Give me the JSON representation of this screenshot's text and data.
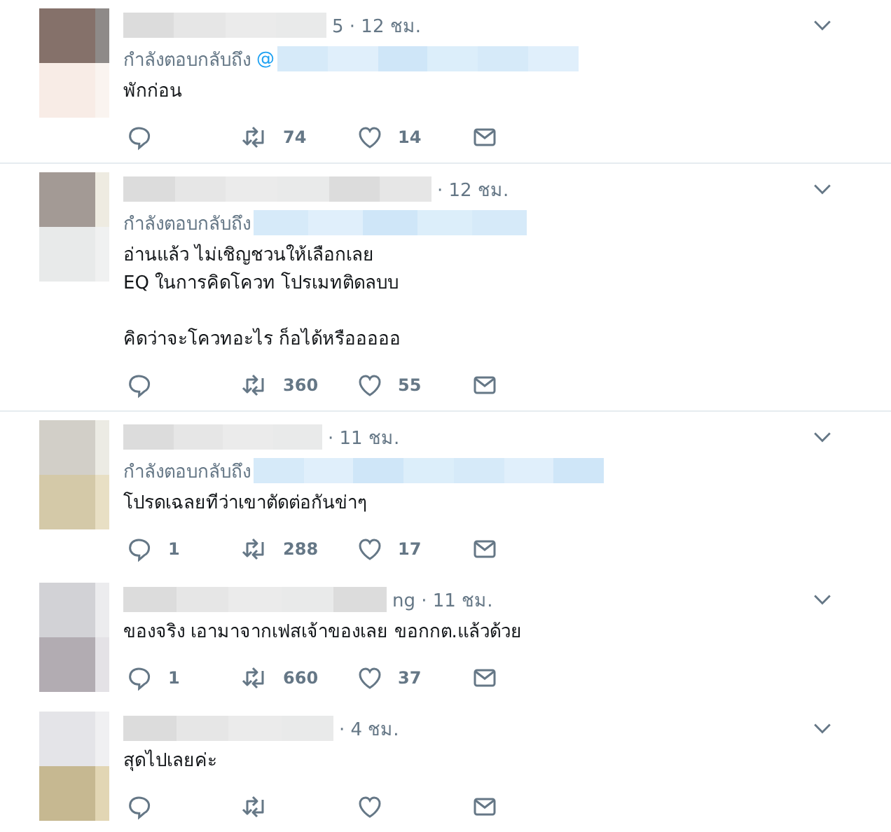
{
  "threads": [
    {
      "tweets": [
        {
          "time": "5 · 12 ชม.",
          "reply_to": {
            "label": "กำลังตอบกลับถึง",
            "handle": "@"
          },
          "text": "พักก่อน",
          "actions": {
            "retweets": "74",
            "likes": "14"
          }
        }
      ]
    },
    {
      "tweets": [
        {
          "time": "· 12 ชม.",
          "reply_to": {
            "label": "กำลังตอบกลับถึง"
          },
          "text": "อ่านแล้ว ไม่เชิญชวนให้เลือกเลย\nEQ ในการคิดโควท โปรเมทติดลบบ\n\nคิดว่าจะโควทอะไร ก็อได้หรือออออ",
          "actions": {
            "retweets": "360",
            "likes": "55"
          }
        }
      ]
    },
    {
      "tweets": [
        {
          "time": "· 11 ชม.",
          "reply_to": {
            "label": "กำลังตอบกลับถึง"
          },
          "text": "โปรดเฉลยทีว่าเขาตัดต่อกันข่าๆ",
          "actions": {
            "replies": "1",
            "retweets": "288",
            "likes": "17"
          }
        },
        {
          "time": "ng · 11 ชม.",
          "text": "ของจริง เอามาจากเฟสเจ้าของเลย ขอกกต.แล้วด้วย",
          "actions": {
            "replies": "1",
            "retweets": "660",
            "likes": "37"
          }
        },
        {
          "time": "· 4 ชม.",
          "text": "สุดไปเลยค่ะ"
        }
      ]
    }
  ]
}
